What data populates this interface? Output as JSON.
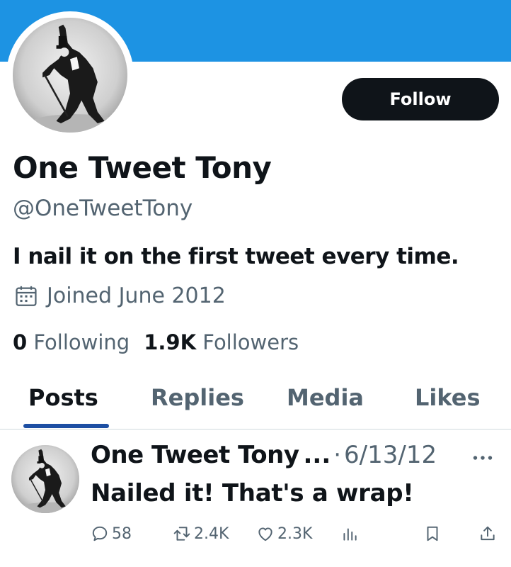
{
  "profile": {
    "display_name": "One Tweet Tony",
    "handle": "@OneTweetTony",
    "bio": "I nail it on the first tweet every time.",
    "joined": "Joined June 2012",
    "follow_label": "Follow",
    "avatar_icon": "avatar-photo-dancer-top-hat",
    "banner_color": "#1d93e3"
  },
  "stats": {
    "following_count": "0",
    "following_label": "Following",
    "followers_count": "1.9K",
    "followers_label": "Followers"
  },
  "tabs": [
    {
      "label": "Posts",
      "active": true
    },
    {
      "label": "Replies",
      "active": false
    },
    {
      "label": "Media",
      "active": false
    },
    {
      "label": "Likes",
      "active": false
    }
  ],
  "post": {
    "author": "One Tweet Tony",
    "truncation": "...",
    "separator": "·",
    "date": "6/13/12",
    "text": "Nailed it! That's a wrap!",
    "replies": "58",
    "reposts": "2.4K",
    "likes": "2.3K"
  },
  "colors": {
    "text_primary": "#0f1419",
    "text_secondary": "#536471",
    "accent_underline": "#1d4fa3"
  }
}
